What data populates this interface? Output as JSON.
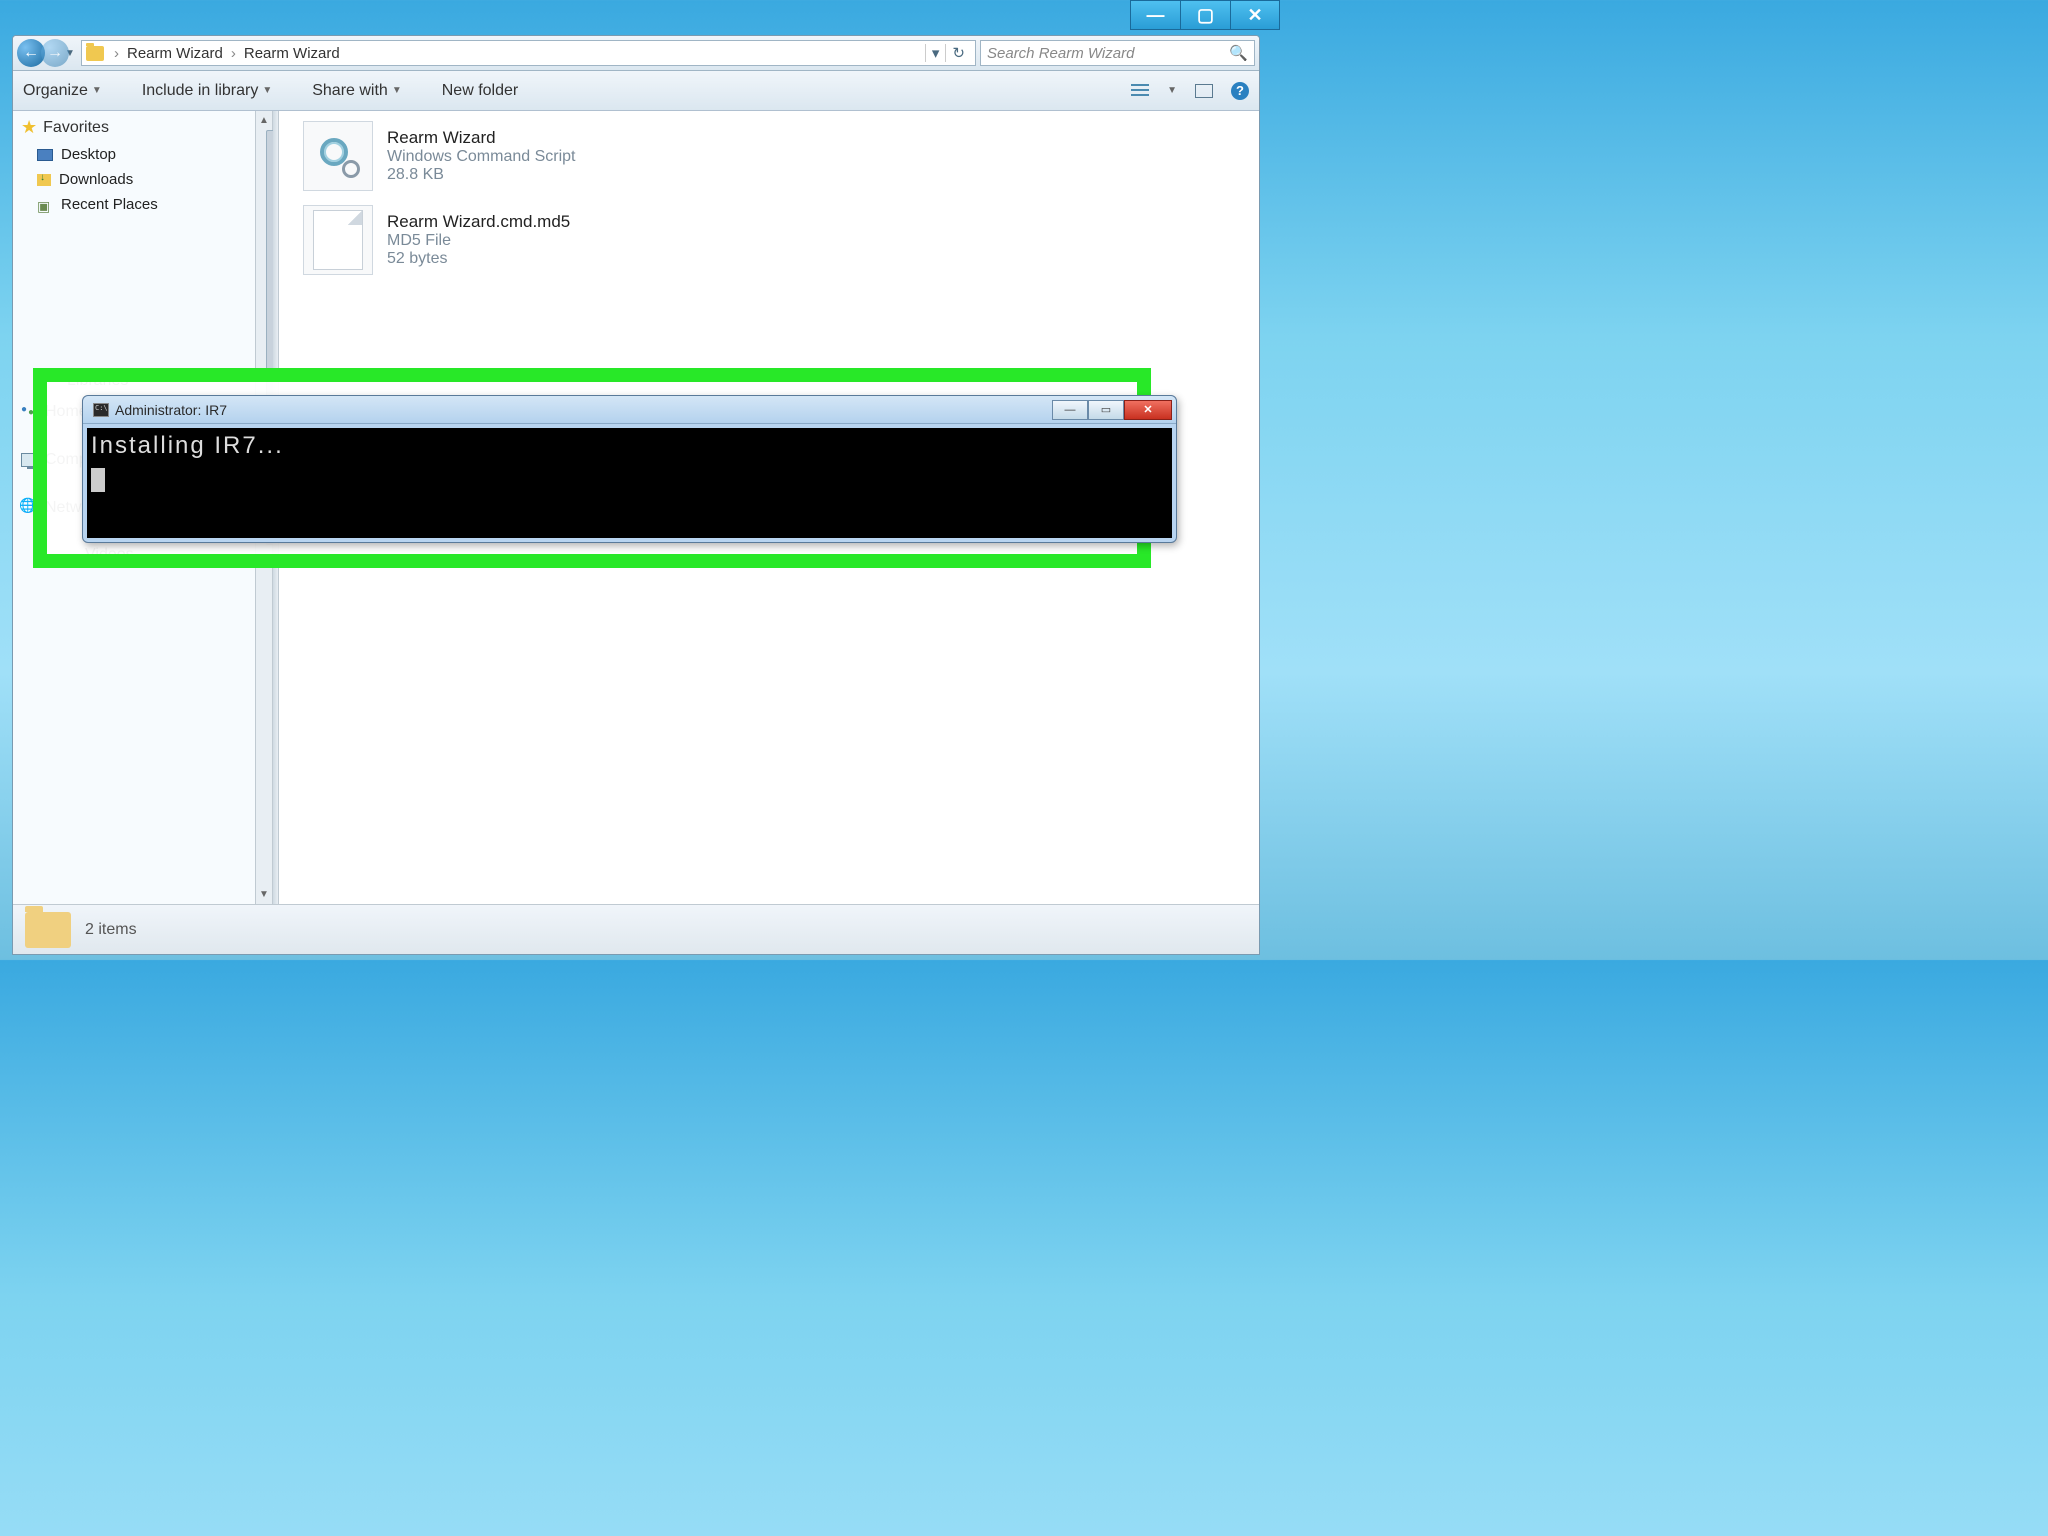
{
  "titlebar": {
    "minimize": "—",
    "maximize": "▢",
    "close": "✕"
  },
  "addressbar": {
    "crumbs": [
      "Rearm Wizard",
      "Rearm Wizard"
    ],
    "sep": "›",
    "dropdown": "▾",
    "refresh": "↻"
  },
  "search": {
    "placeholder": "Search Rearm Wizard",
    "icon": "🔍"
  },
  "toolbar": {
    "organize": "Organize",
    "include": "Include in library",
    "share": "Share with",
    "newfolder": "New folder",
    "help": "?"
  },
  "sidebar": {
    "favorites": "Favorites",
    "items_fav": [
      "Desktop",
      "Downloads",
      "Recent Places"
    ],
    "libraries": "Libraries",
    "videos": "Videos",
    "homegroup": "Homegroup",
    "computer": "Computer",
    "network": "Network"
  },
  "files": [
    {
      "name": "Rearm Wizard",
      "type": "Windows Command Script",
      "size": "28.8 KB"
    },
    {
      "name": "Rearm Wizard.cmd.md5",
      "type": "MD5 File",
      "size": "52 bytes"
    }
  ],
  "status": {
    "text": "2 items"
  },
  "cmd": {
    "title": "Administrator:  IR7",
    "line1": "Installing IR7...",
    "min": "—",
    "max": "▭",
    "close": "✕"
  }
}
